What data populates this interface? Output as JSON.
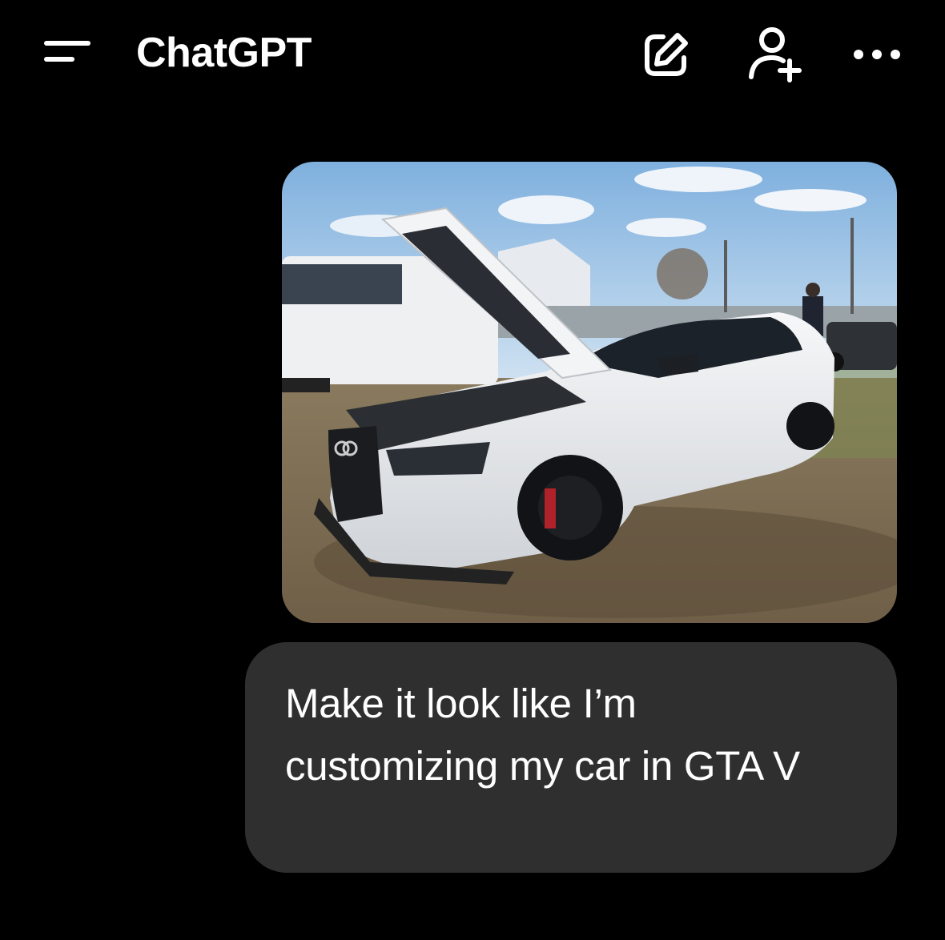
{
  "header": {
    "title": "ChatGPT",
    "menu_icon": "menu-icon",
    "new_chat_icon": "compose-icon",
    "add_people_icon": "add-person-icon",
    "more_icon": "more-horizontal-icon"
  },
  "conversation": {
    "user_image": {
      "subject": "photo",
      "icon": "photo"
    },
    "user_message": "Make it look like I’m customizing my car in GTA V"
  },
  "colors": {
    "background": "#000000",
    "bubble": "#2f2f2f",
    "text": "#ffffff"
  }
}
